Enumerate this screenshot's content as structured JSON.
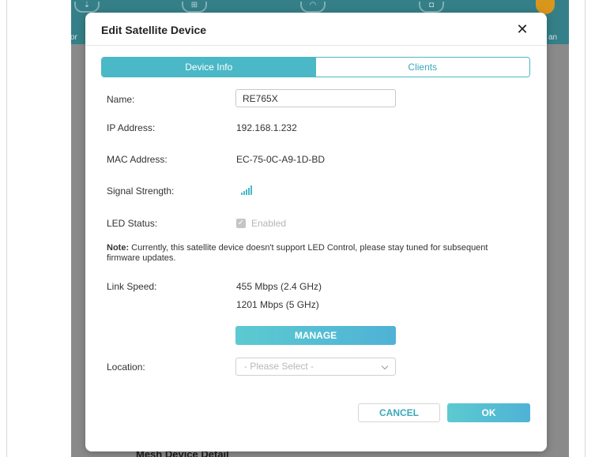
{
  "background": {
    "left_label": "vor",
    "right_label": "an",
    "section_title": "Mesh Device Detail"
  },
  "modal": {
    "title": "Edit Satellite Device",
    "close_symbol": "✕",
    "tabs": [
      {
        "label": "Device Info",
        "active": true
      },
      {
        "label": "Clients",
        "active": false
      }
    ],
    "fields": {
      "name_label": "Name:",
      "name_value": "RE765X",
      "ip_label": "IP Address:",
      "ip_value": "192.168.1.232",
      "mac_label": "MAC Address:",
      "mac_value": "EC-75-0C-A9-1D-BD",
      "signal_label": "Signal Strength:",
      "signal_icon": "signal-bars-icon",
      "led_label": "LED Status:",
      "led_checkbox_label": "Enabled",
      "led_checked": true,
      "note_prefix": "Note:",
      "note_text": " Currently, this satellite device doesn't support LED Control, please stay tuned for subsequent firmware updates.",
      "link_speed_label": "Link Speed:",
      "link_speed_24": "455 Mbps (2.4 GHz)",
      "link_speed_5": "1201 Mbps (5 GHz)",
      "manage_label": "MANAGE",
      "location_label": "Location:",
      "location_placeholder": "- Please Select -"
    },
    "footer": {
      "cancel_label": "CANCEL",
      "ok_label": "OK"
    }
  },
  "colors": {
    "accent": "#4ab8c6",
    "topbar": "#357f88",
    "overlay": "#858585"
  }
}
